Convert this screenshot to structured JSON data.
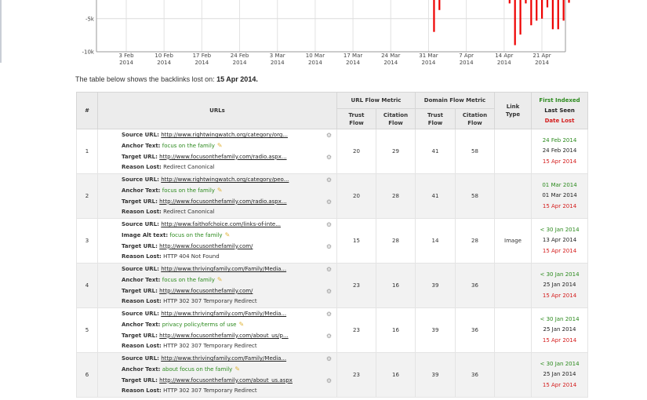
{
  "chart_data": {
    "type": "bar",
    "y_ticks": [
      "-5k",
      "-10k"
    ],
    "x_ticks": [
      {
        "line1": "3 Feb",
        "line2": "2014"
      },
      {
        "line1": "10 Feb",
        "line2": "2014"
      },
      {
        "line1": "17 Feb",
        "line2": "2014"
      },
      {
        "line1": "24 Feb",
        "line2": "2014"
      },
      {
        "line1": "3 Mar",
        "line2": "2014"
      },
      {
        "line1": "10 Mar",
        "line2": "2014"
      },
      {
        "line1": "17 Mar",
        "line2": "2014"
      },
      {
        "line1": "24 Mar",
        "line2": "2014"
      },
      {
        "line1": "31 Mar",
        "line2": "2014"
      },
      {
        "line1": "7 Apr",
        "line2": "2014"
      },
      {
        "line1": "14 Apr",
        "line2": "2014"
      },
      {
        "line1": "21 Apr",
        "line2": "2014"
      }
    ],
    "ylim_visible": [
      -10000,
      -1000
    ],
    "bar_color": "#ee0000",
    "bars": [
      {
        "x": "2014-04-01",
        "value": -7000
      },
      {
        "x": "2014-04-02",
        "value": -3700
      },
      {
        "x": "2014-04-15",
        "value": -2700
      },
      {
        "x": "2014-04-16",
        "value": -9000
      },
      {
        "x": "2014-04-17",
        "value": -7400
      },
      {
        "x": "2014-04-18",
        "value": -2700
      },
      {
        "x": "2014-04-19",
        "value": -6000
      },
      {
        "x": "2014-04-20",
        "value": -5300
      },
      {
        "x": "2014-04-21",
        "value": -5000
      },
      {
        "x": "2014-04-22",
        "value": -3300
      },
      {
        "x": "2014-04-23",
        "value": -6600
      },
      {
        "x": "2014-04-24",
        "value": -6600
      },
      {
        "x": "2014-04-25",
        "value": -5300
      },
      {
        "x": "2014-04-26",
        "value": -2600
      }
    ]
  },
  "intro": {
    "text": "The table below shows the backlinks lost on:",
    "date": "15 Apr 2014."
  },
  "table": {
    "headers": {
      "num": "#",
      "urls": "URLs",
      "url_flow": "URL Flow Metric",
      "domain_flow": "Domain Flow Metric",
      "link_type_1": "Link",
      "link_type_2": "Type",
      "first_indexed": "First Indexed",
      "last_seen": "Last Seen",
      "date_lost": "Date Lost",
      "trust_1": "Trust",
      "trust_2": "Flow",
      "citation_1": "Citation",
      "citation_2": "Flow"
    },
    "rows": [
      {
        "num": "1",
        "source": "http://www.rightwingwatch.org/category/org...",
        "anchor_label": "Anchor Text:",
        "anchor": "focus on the family",
        "target": "http://www.focusonthefamily.com/radio.aspx...",
        "reason": "Redirect Canonical",
        "url_tf": "20",
        "url_cf": "29",
        "dom_tf": "41",
        "dom_cf": "58",
        "link_type": "",
        "first": "24 Feb 2014",
        "last": "24 Feb 2014",
        "lost": "15 Apr 2014"
      },
      {
        "num": "2",
        "source": "http://www.rightwingwatch.org/category/peo...",
        "anchor_label": "Anchor Text:",
        "anchor": "focus on the family",
        "target": "http://www.focusonthefamily.com/radio.aspx...",
        "reason": "Redirect Canonical",
        "url_tf": "20",
        "url_cf": "28",
        "dom_tf": "41",
        "dom_cf": "58",
        "link_type": "",
        "first": "01 Mar 2014",
        "last": "01 Mar 2014",
        "lost": "15 Apr 2014"
      },
      {
        "num": "3",
        "source": "http://www.faithofchoice.com/links-of-inte...",
        "anchor_label": "Image Alt text:",
        "anchor": "focus on the family",
        "target": "http://www.focusonthefamily.com/",
        "reason": "HTTP 404 Not Found",
        "url_tf": "15",
        "url_cf": "28",
        "dom_tf": "14",
        "dom_cf": "28",
        "link_type": "Image",
        "first": "< 30 Jan 2014",
        "last": "13 Apr 2014",
        "lost": "15 Apr 2014"
      },
      {
        "num": "4",
        "source": "http://www.thrivingfamily.com/Family/Media...",
        "anchor_label": "Anchor Text:",
        "anchor": "focus on the family",
        "target": "http://www.focusonthefamily.com/",
        "reason": "HTTP 302 307 Temporary Redirect",
        "url_tf": "23",
        "url_cf": "16",
        "dom_tf": "39",
        "dom_cf": "36",
        "link_type": "",
        "first": "< 30 Jan 2014",
        "last": "25 Jan 2014",
        "lost": "15 Apr 2014"
      },
      {
        "num": "5",
        "source": "http://www.thrivingfamily.com/Family/Media...",
        "anchor_label": "Anchor Text:",
        "anchor": "privacy policy/terms of use",
        "target": "http://www.focusonthefamily.com/about_us/p...",
        "reason": "HTTP 302 307 Temporary Redirect",
        "url_tf": "23",
        "url_cf": "16",
        "dom_tf": "39",
        "dom_cf": "36",
        "link_type": "",
        "first": "< 30 Jan 2014",
        "last": "25 Jan 2014",
        "lost": "15 Apr 2014"
      },
      {
        "num": "6",
        "source": "http://www.thrivingfamily.com/Family/Media...",
        "anchor_label": "Anchor Text:",
        "anchor": "about focus on the family",
        "target": "http://www.focusonthefamily.com/about_us.aspx",
        "reason": "HTTP 302 307 Temporary Redirect",
        "url_tf": "23",
        "url_cf": "16",
        "dom_tf": "39",
        "dom_cf": "36",
        "link_type": "",
        "first": "< 30 Jan 2014",
        "last": "25 Jan 2014",
        "lost": "15 Apr 2014"
      }
    ],
    "labels": {
      "source": "Source URL:",
      "target": "Target URL:",
      "reason": "Reason Lost:"
    }
  }
}
